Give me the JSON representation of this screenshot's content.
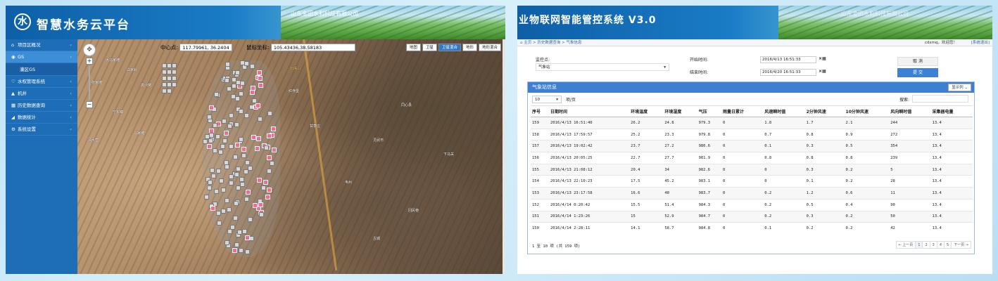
{
  "left": {
    "header": {
      "logo_glyph": "水",
      "title": "智慧水务云平台",
      "company": "山东金田水利科技有限公司"
    },
    "sidebar": {
      "items": [
        {
          "icon": "⌂",
          "label": "项目区概况",
          "chevron": "‹"
        },
        {
          "icon": "◉",
          "label": "GS",
          "chevron": "›",
          "active": true
        },
        {
          "icon": "",
          "label": "灌区GS",
          "sub": true
        },
        {
          "icon": "♡",
          "label": "水权管理系统",
          "chevron": "‹"
        },
        {
          "icon": "▲",
          "label": "机井",
          "chevron": "‹"
        },
        {
          "icon": "▦",
          "label": "历史数据查询",
          "chevron": "‹"
        },
        {
          "icon": "◢",
          "label": "数据统计",
          "chevron": "‹"
        },
        {
          "icon": "⚙",
          "label": "系统设置",
          "chevron": "‹"
        }
      ]
    },
    "map": {
      "center_label": "中心点:",
      "center_value": "117.79961, 36.2404",
      "mouse_label": "鼠标坐标:",
      "mouse_value": "105.43436,38.58183",
      "types": [
        "地图",
        "卫星",
        "卫星混合",
        "地形",
        "地形混合"
      ],
      "active_type": "卫星混合",
      "road_label": "石嘴山",
      "places": [
        "大马家滩",
        "白家岭",
        "张家滩",
        "高沙窝",
        "宁东镇",
        "清水营",
        "马家滩",
        "红寺堡",
        "甘草庄",
        "灵武市",
        "同心县",
        "下马关",
        "韦州",
        "回民巷",
        "古城"
      ]
    }
  },
  "right": {
    "header": {
      "title": "业物联网智能管控系统 V3.0",
      "company": "山东金田水利科技有限公司"
    },
    "breadcrumb": {
      "home": "主页",
      "level2": "历史数据查询",
      "level3": "气象信息",
      "sep": ">",
      "user": "cdxmq，欢迎您！",
      "logout": "[系统退出]"
    },
    "form": {
      "station_label": "监控点:",
      "station_value": "气象站",
      "start_label": "开始时间:",
      "start_value": "2016/4/13 16:51:33",
      "end_label": "结束时间:",
      "end_value": "2016/4/20 16:51:33",
      "clear_icon": "×▦",
      "cancel": "取 消",
      "submit": "提 交"
    },
    "panel": {
      "title": "气象站信息",
      "columns_button": "显示列 ⌄",
      "page_size": "10",
      "page_size_suffix": "项/页",
      "search_label": "搜索:",
      "columns": [
        "序号",
        "日期时间",
        "环境温度",
        "环境湿度",
        "气压",
        "雨量日累计",
        "风速瞬时值",
        "2分钟风速",
        "10分钟风速",
        "风向瞬时值",
        "采集器电量"
      ],
      "rows": [
        [
          "159",
          "2016/4/13 16:51:40",
          "26.2",
          "24.8",
          "979.3",
          "0",
          "1.8",
          "1.7",
          "2.1",
          "244",
          "13.4"
        ],
        [
          "158",
          "2016/4/13 17:59:57",
          "25.2",
          "23.3",
          "979.8",
          "0",
          "0.7",
          "0.8",
          "0.9",
          "272",
          "13.4"
        ],
        [
          "157",
          "2016/4/13 19:02:42",
          "23.7",
          "27.2",
          "980.6",
          "0",
          "0.1",
          "0.3",
          "0.5",
          "354",
          "13.4"
        ],
        [
          "156",
          "2016/4/13 20:05:25",
          "22.7",
          "27.7",
          "981.9",
          "0",
          "0.8",
          "0.8",
          "0.8",
          "239",
          "13.4"
        ],
        [
          "155",
          "2016/4/13 21:08:12",
          "20.4",
          "34",
          "982.6",
          "0",
          "0",
          "0.3",
          "0.2",
          "5",
          "13.4"
        ],
        [
          "154",
          "2016/4/13 22:10:23",
          "17.5",
          "45.2",
          "983.1",
          "0",
          "0",
          "0.1",
          "0.2",
          "28",
          "13.4"
        ],
        [
          "153",
          "2016/4/13 23:17:58",
          "16.6",
          "48",
          "983.7",
          "0",
          "0.2",
          "1.2",
          "0.6",
          "11",
          "13.4"
        ],
        [
          "152",
          "2016/4/14 0:20:42",
          "15.5",
          "51.4",
          "984.3",
          "0",
          "0.2",
          "0.5",
          "0.4",
          "90",
          "13.4"
        ],
        [
          "151",
          "2016/4/14 1:23:26",
          "15",
          "52.9",
          "984.7",
          "0",
          "0.2",
          "0.3",
          "0.2",
          "50",
          "13.4"
        ],
        [
          "150",
          "2016/4/14 2:28:11",
          "14.1",
          "58.7",
          "984.8",
          "0",
          "0.1",
          "0.2",
          "0.2",
          "42",
          "13.4"
        ]
      ],
      "footer_info": "1 至 10 项 (共 159 项)",
      "pager": [
        "← 上一页",
        "1",
        "2",
        "3",
        "4",
        "5",
        "下一页 →"
      ]
    }
  }
}
